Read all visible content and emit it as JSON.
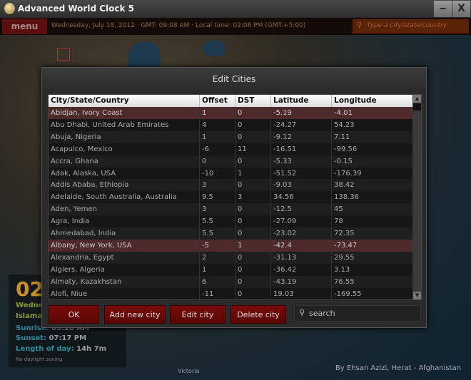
{
  "window": {
    "title": "Advanced World Clock 5",
    "minimize": "‒",
    "close": "X"
  },
  "toolbar": {
    "menu": "menu",
    "datetime": "Wednesday, July 18, 2012 · GMT: 09:08 AM · Local time: 02:08 PM (GMT:+5:00)",
    "city_search_placeholder": "Type a city/state/country",
    "search_icon": "⚲"
  },
  "left_panel": {
    "clock": "02",
    "line1": "Wedne",
    "line2": "Islama",
    "sunrise_label": "Sunrise:",
    "sunrise": "05:20 AM",
    "sunset_label": "Sunset:",
    "sunset": "07:17 PM",
    "length_label": "Length of day:",
    "length": "14h 7m",
    "dst": "No daylight saving"
  },
  "map_labels": {
    "victoria": "Victoria"
  },
  "credit": "By Ehsan Azizi, Herat - Afghanistan",
  "dialog": {
    "title": "Edit Cities",
    "columns": [
      "City/State/Country",
      "Offset",
      "DST",
      "Latitude",
      "Longitude"
    ],
    "rows": [
      [
        "Abidjan, Ivory Coast",
        "1",
        "0",
        "-5.19",
        "-4.01"
      ],
      [
        "Abu Dhabi, United Arab Emirates",
        "4",
        "0",
        "-24.27",
        "54.23"
      ],
      [
        "Abuja, Nigeria",
        "1",
        "0",
        "-9.12",
        "7.11"
      ],
      [
        "Acapulco, Mexico",
        "-6",
        "11",
        "-16.51",
        "-99.56"
      ],
      [
        "Accra, Ghana",
        "0",
        "0",
        "-5.33",
        "-0.15"
      ],
      [
        "Adak, Alaska, USA",
        "-10",
        "1",
        "-51.52",
        "-176.39"
      ],
      [
        "Addis Ababa, Ethiopia",
        "3",
        "0",
        "-9.03",
        "38.42"
      ],
      [
        "Adelaide, South Australia, Australia",
        "9.5",
        "3",
        "34.56",
        "138.36"
      ],
      [
        "Aden, Yemen",
        "3",
        "0",
        "-12.5",
        "45"
      ],
      [
        "Agra, India",
        "5.5",
        "0",
        "-27.09",
        "78"
      ],
      [
        "Ahmedabad, India",
        "5.5",
        "0",
        "-23.02",
        "72.35"
      ],
      [
        "Albany, New York, USA",
        "-5",
        "1",
        "-42.4",
        "-73.47"
      ],
      [
        "Alexandria, Egypt",
        "2",
        "0",
        "-31.13",
        "29.55"
      ],
      [
        "Algiers, Algeria",
        "1",
        "0",
        "-36.42",
        "3.13"
      ],
      [
        "Almaty, Kazakhstan",
        "6",
        "0",
        "-43.19",
        "76.55"
      ],
      [
        "Alofi, Niue",
        "-11",
        "0",
        "19.03",
        "-169.55"
      ]
    ],
    "selected_rows": [
      0,
      11
    ],
    "buttons": {
      "ok": "OK",
      "add": "Add new city",
      "edit": "Edit city",
      "delete": "Delete city"
    },
    "search_placeholder": "search",
    "search_icon": "⚲"
  },
  "colors": {
    "accent": "#7a0a0a",
    "selected_row": "#4e2a2a",
    "clock": "#c8902a"
  }
}
